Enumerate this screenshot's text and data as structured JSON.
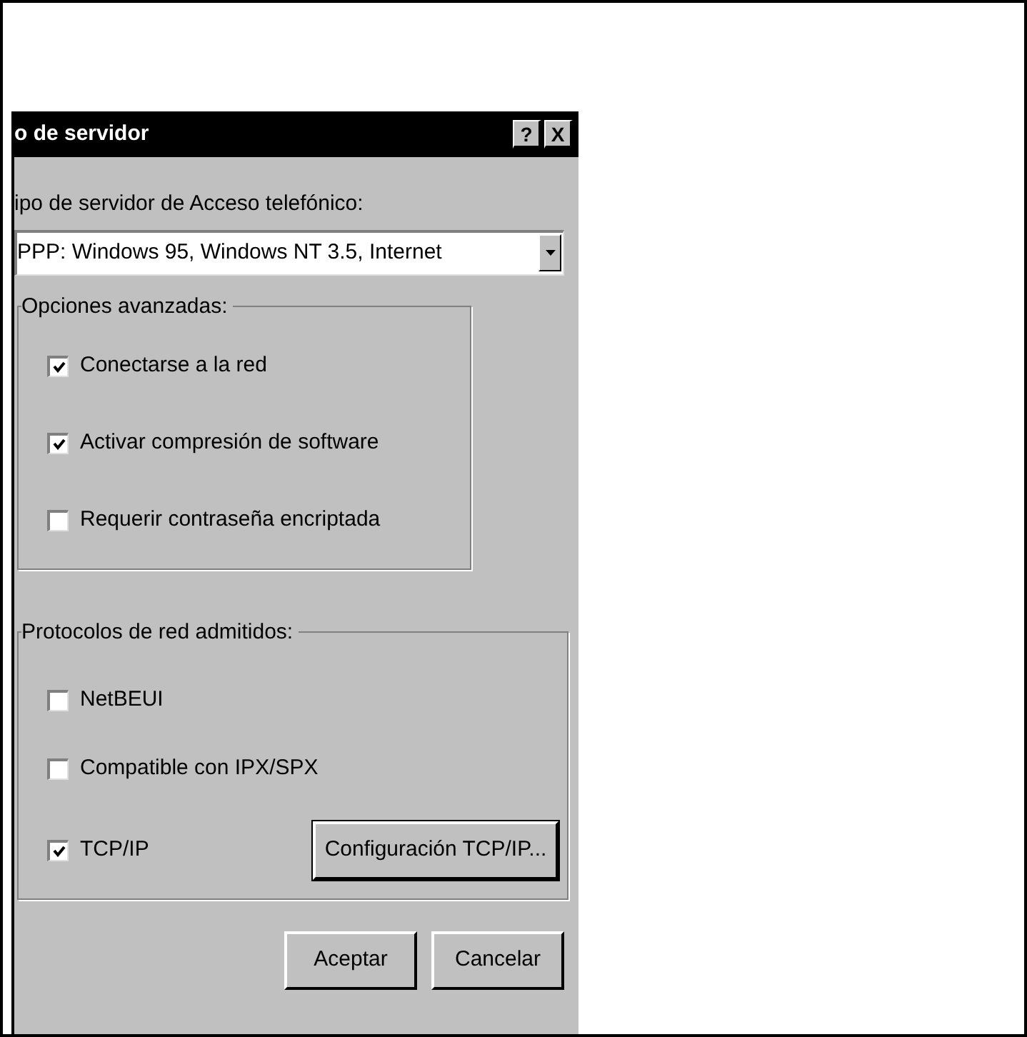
{
  "window": {
    "title": "o de servidor",
    "title_buttons": [
      "?",
      "X"
    ]
  },
  "server_type": {
    "label": "ipo de servidor de Acceso telefónico:",
    "value": "PPP: Windows 95, Windows NT 3.5, Internet"
  },
  "groups": [
    {
      "title": "Opciones avanzadas:",
      "options": [
        {
          "label": "Conectarse a la red",
          "checked": true
        },
        {
          "label": "Activar compresión de software",
          "checked": true
        },
        {
          "label": "Requerir contraseña encriptada",
          "checked": false
        }
      ]
    },
    {
      "title": "Protocolos de red admitidos:",
      "options": [
        {
          "label": "NetBEUI",
          "checked": false
        },
        {
          "label": "Compatible con IPX/SPX",
          "checked": false
        },
        {
          "label": "TCP/IP",
          "checked": true,
          "button": "Configuración TCP/IP..."
        }
      ]
    }
  ],
  "buttons": [
    "Aceptar",
    "Cancelar"
  ]
}
